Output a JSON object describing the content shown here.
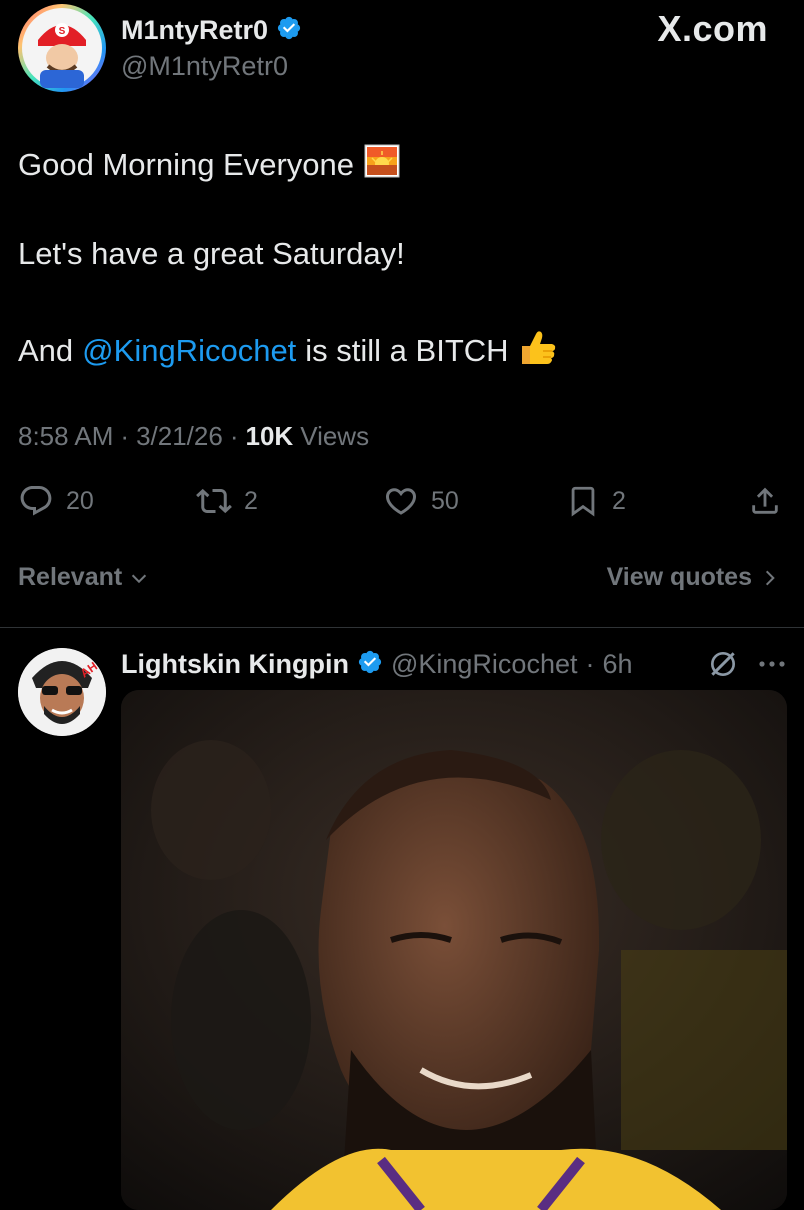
{
  "colors": {
    "background": "#000000",
    "text": "#e7e9ea",
    "muted": "#71767b",
    "link": "#1d9bf0",
    "verified": "#1d9bf0"
  },
  "main_tweet": {
    "author_name": "M1ntyRetr0",
    "handle": "@M1ntyRetr0",
    "brand": "X.com",
    "line1": "Good Morning Everyone",
    "line1_emoji": "sunrise-emoji",
    "line2": "Let's have a great Saturday!",
    "line3_prefix": "And",
    "line3_mention": "@KingRicochet",
    "line3_suffix": "is still a BITCH",
    "line3_emoji": "thumbs-up-emoji",
    "time": "8:58 AM",
    "date": "3/21/26",
    "views_count": "10K",
    "views_label": "Views",
    "separator": "·"
  },
  "actions": {
    "replies": "20",
    "reposts": "2",
    "likes": "50",
    "bookmarks": "2"
  },
  "filter": {
    "sort_label": "Relevant",
    "quotes_label": "View quotes"
  },
  "reply": {
    "author_name": "Lightskin Kingpin",
    "handle": "@KingRicochet",
    "separator": "·",
    "time": "6h"
  }
}
